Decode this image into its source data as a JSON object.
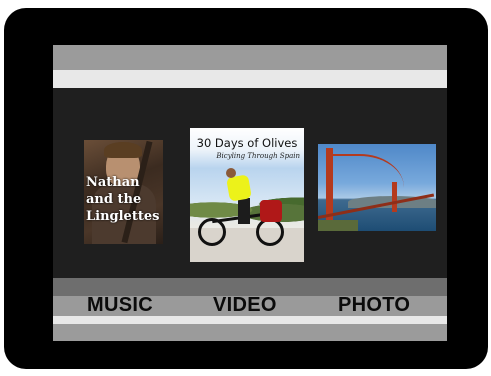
{
  "menu": {
    "items": [
      {
        "label": "MUSIC"
      },
      {
        "label": "VIDEO"
      },
      {
        "label": "PHOTO"
      }
    ]
  },
  "covers": {
    "music": {
      "title": "Nathan\nand the\nLinglettes"
    },
    "video": {
      "title": "30 Days of Olives",
      "subtitle": "Bicyling Through Spain"
    },
    "photo": {
      "subject": "Golden Gate Bridge"
    }
  },
  "colors": {
    "bezel": "#000000",
    "screen": "#1f1f1f",
    "band_gray": "#9b9b9b",
    "band_light": "#e8e8e8",
    "bridge_red": "#b43a1e",
    "jersey_yellow": "#ecf21a"
  }
}
